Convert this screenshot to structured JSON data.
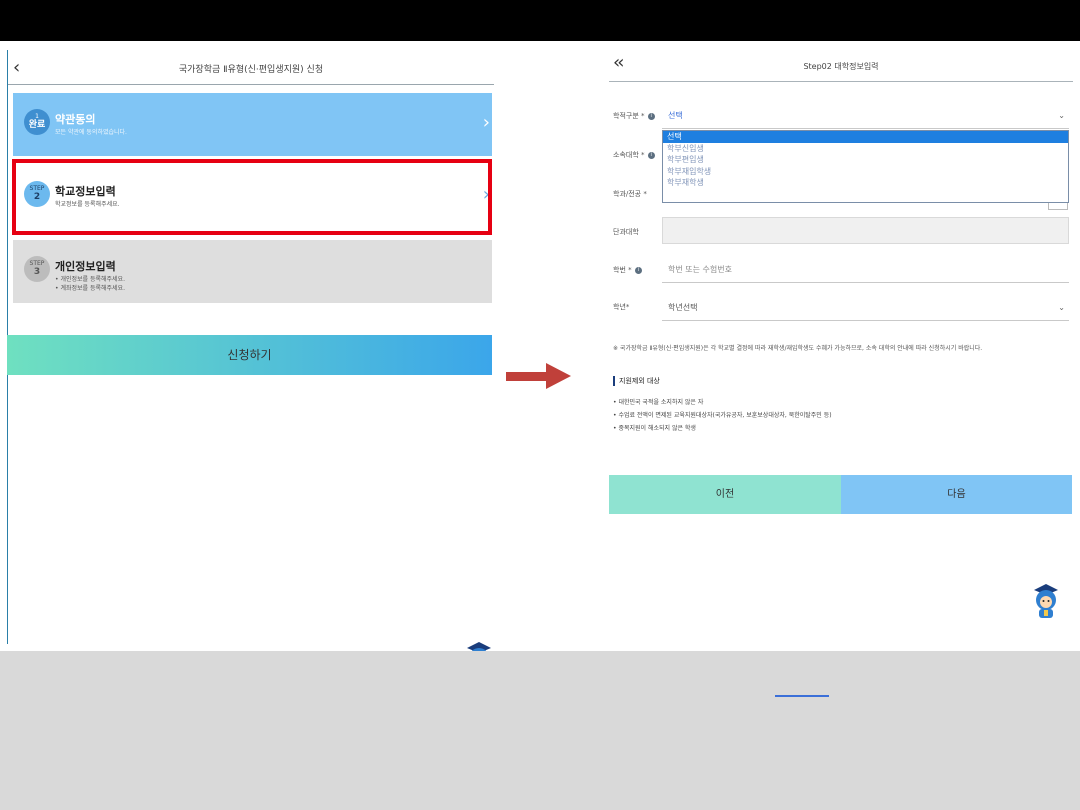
{
  "left_panel": {
    "title": "국가장학금 Ⅱ유형(신·편입생지원) 신청",
    "back_icon": "chevron-left-icon",
    "steps": [
      {
        "badge_top": "1",
        "badge_bottom": "완료",
        "name": "약관동의",
        "desc": [
          "모든 약관에 동의하였습니다."
        ]
      },
      {
        "badge_top": "STEP",
        "badge_bottom": "2",
        "name": "학교정보입력",
        "desc": [
          "학교정보를 등록해주세요."
        ]
      },
      {
        "badge_top": "STEP",
        "badge_bottom": "3",
        "name": "개인정보입력",
        "desc": [
          "• 개인정보를 등록해주세요.",
          "• 계좌정보를 등록해주세요."
        ]
      }
    ],
    "apply_label": "신청하기"
  },
  "right_panel": {
    "title": "Step02 대학정보입력",
    "back_icon": "double-chevron-left-icon",
    "fields": {
      "student_type": {
        "label": "학적구분 *",
        "value": "선택"
      },
      "university": {
        "label": "소속대학 *"
      },
      "major": {
        "label": "학과/전공 *"
      },
      "college": {
        "label": "단과대학"
      },
      "student_id": {
        "label": "학번 *",
        "placeholder": "학번 또는 수험번호"
      },
      "grade": {
        "label": "학년*",
        "value": "학년선택"
      }
    },
    "dropdown_options": [
      "선택",
      "학부신입생",
      "학부편입생",
      "학부재입학생",
      "학부재학생"
    ],
    "notice": "※ 국가장학금 Ⅱ유형(신·편입생지원)은 각 학교별 결정에 따라 재학생/재입학생도 수혜가 가능하므로, 소속 대학의 안내에 따라 신청하시기 바랍니다.",
    "exclusion_title": "지원제외 대상",
    "exclusion_items": [
      "• 대한민국 국적을 소지하지 않은 자",
      "• 수업료 전액이 면제된 교육지원대상자(국가유공자, 보훈보상대상자, 북한이탈주민 등)",
      "• 중복지원이 해소되지 않은 학생"
    ],
    "prev_label": "이전",
    "next_label": "다음"
  },
  "colors": {
    "step1_bg": "#80c5f5",
    "highlight": "#e60012",
    "arrow": "#c0403a",
    "prev_bg": "#8fe3d1",
    "next_bg": "#80c5f5"
  }
}
